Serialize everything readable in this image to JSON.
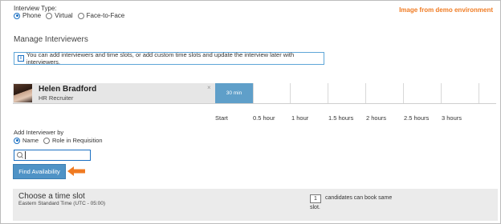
{
  "interview_type": {
    "label": "Interview Type:",
    "options": [
      "Phone",
      "Virtual",
      "Face-to-Face"
    ],
    "selected": "Phone"
  },
  "demo_note": "Image from demo environment",
  "manage": {
    "title": "Manage Interviewers",
    "info": "You can add interviewers and time slots, or add custom time slots and update the interview later with interviewers."
  },
  "interviewer": {
    "name": "Helen Bradford",
    "role": "HR Recruiter",
    "remove_glyph": "×",
    "selected_slot": "30 min"
  },
  "durations": [
    "Start",
    "0.5 hour",
    "1 hour",
    "1.5 hours",
    "2 hours",
    "2.5 hours",
    "3 hours"
  ],
  "add_interviewer": {
    "label": "Add Interviewer by",
    "options": [
      "Name",
      "Role in Requisition"
    ],
    "selected": "Name",
    "search_value": ""
  },
  "find_button": "Find Availability",
  "timeslot": {
    "title": "Choose a time slot",
    "timezone": "Eastern Standard Time (UTC - 05:00)",
    "candidates_count": "1",
    "candidates_text": "candidates can book same",
    "slot_word": "slot."
  },
  "colors": {
    "accent": "#1a6fc2",
    "button": "#4f93c6",
    "note": "#f07b22",
    "slot": "#5f9fc9"
  }
}
